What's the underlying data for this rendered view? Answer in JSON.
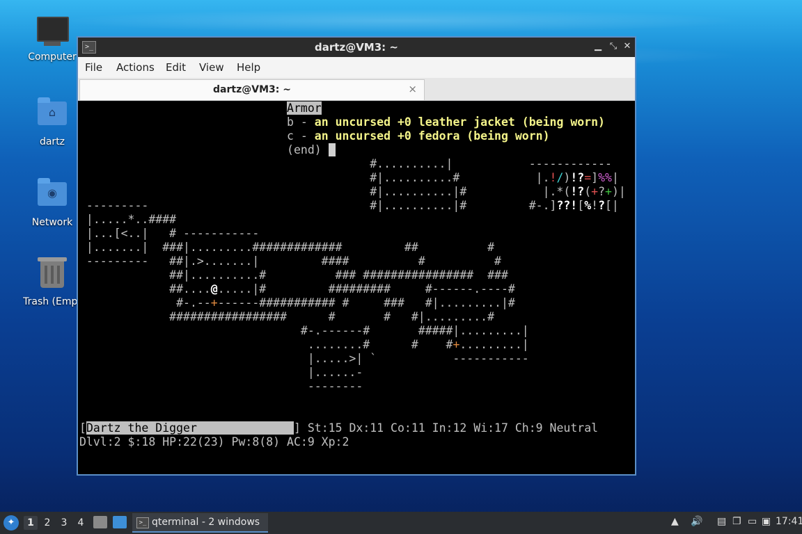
{
  "desktop": {
    "icons": [
      {
        "label": "Computer",
        "icon": "computer-icon"
      },
      {
        "label": "dartz",
        "icon": "home-folder-icon"
      },
      {
        "label": "Network",
        "icon": "network-folder-icon"
      },
      {
        "label": "Trash (Empt",
        "icon": "trash-icon"
      }
    ]
  },
  "window": {
    "title": "dartz@VM3: ~",
    "app_icon": "terminal-icon",
    "controls": [
      "minimize-icon",
      "restore-icon",
      "close-icon"
    ],
    "menu": [
      "File",
      "Actions",
      "Edit",
      "View",
      "Help"
    ],
    "tab": {
      "label": "dartz@VM3: ~",
      "close": "×"
    }
  },
  "terminal": {
    "lines": [
      "                               Armor",
      "                               b - an uncursed +0 leather jacket (being worn)",
      "                               c - an uncursed +0 fedora (being worn)",
      "                               (end)",
      "                                          #..........|",
      "                                          #|..........#",
      "                                          #|..........|#",
      "                                          #|..........|#",
      "                                          #|..........|##",
      "                                          #----------- #",
      "                                                       ##",
      "                                          ####          #",
      "                                             ### ################  ###",
      "                                            #########     #------.----#",
      "                                          #      ###   #|.........|#",
      "                                        ##     #    #   #|.........#",
      "                                           #####|.........|",
      "                                        #    #+.........|",
      "                                                   -----------"
    ],
    "inventory_header": "Armor",
    "inventory_items": [
      {
        "letter": "b",
        "text": "an uncursed +0 leather jacket (being worn)"
      },
      {
        "letter": "c",
        "text": "an uncursed +0 fedora (being worn)"
      }
    ],
    "end_marker": "(end)",
    "status_name": "Dartz the Digger",
    "status_line1_rest": "St:15 Dx:11 Co:11 In:12 Wi:17 Ch:9 Neutral",
    "status_line2": "Dlvl:2 $:18 HP:22(23) Pw:8(8) AC:9 Xp:2"
  },
  "taskbar": {
    "start_icon": "lxqt-menu-icon",
    "workspaces": [
      "1",
      "2",
      "3",
      "4"
    ],
    "active_workspace": "1",
    "task_label": "qterminal - 2 windows",
    "clock": "17:41",
    "tray_icons": [
      "tray-up-arrow-icon",
      "volume-icon",
      "clipboard-icon",
      "update-notifier-icon",
      "network-tray-icon",
      "display-tray-icon"
    ]
  }
}
